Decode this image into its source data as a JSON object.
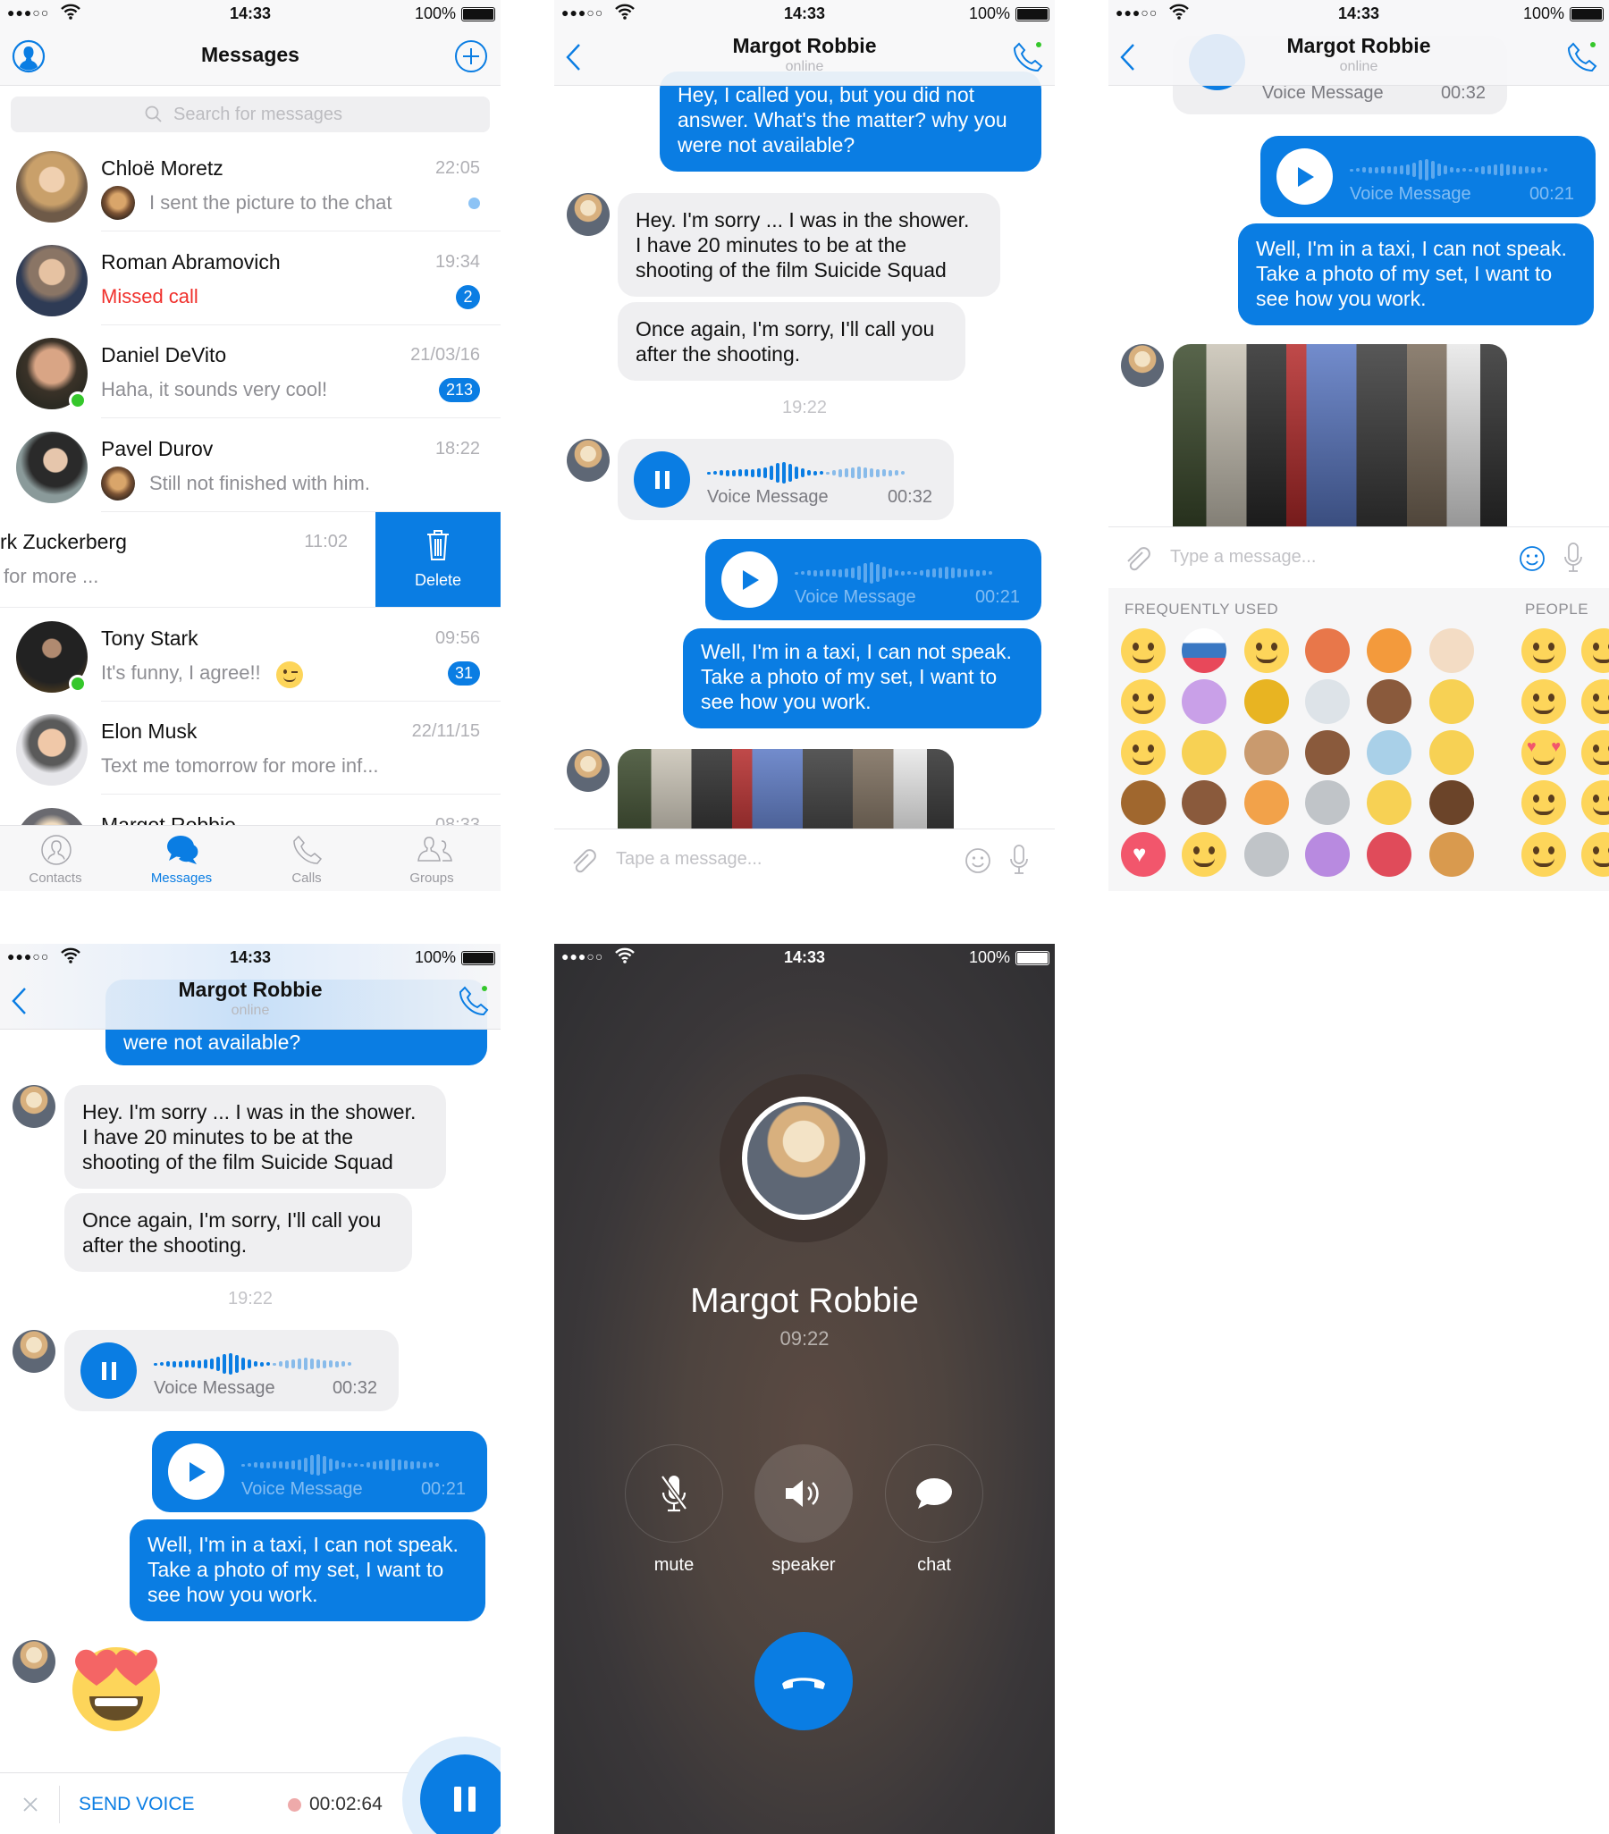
{
  "status_bar": {
    "signal": "●●●○○",
    "time": "14:33",
    "battery": "100%"
  },
  "colors": {
    "accent": "#0a7de3",
    "missed": "#f0302c",
    "online": "#35c72b",
    "end_call": "#0a7de3"
  },
  "messages_screen": {
    "title": "Messages",
    "search_placeholder": "Search for messages",
    "delete_label": "Delete",
    "conversations": [
      {
        "name": "Chloë Moretz",
        "time": "22:05",
        "preview": "I sent the picture to the chat",
        "thumb": true,
        "unread_dot": true
      },
      {
        "name": "Roman Abramovich",
        "time": "19:34",
        "preview": "Missed call",
        "missed": true,
        "badge": "2"
      },
      {
        "name": "Daniel DeVito",
        "time": "21/03/16",
        "preview": "Haha, it sounds very cool!",
        "badge": "213",
        "online": true
      },
      {
        "name": "Pavel Durov",
        "time": "18:22",
        "preview": "Still not finished with him.",
        "thumb": true
      },
      {
        "name": "rk Zuckerberg",
        "time": "11:02",
        "preview": "for more ...",
        "swiped": true
      },
      {
        "name": "Tony Stark",
        "time": "09:56",
        "preview": "It's funny, I agree!!",
        "emoji": "winking-face",
        "badge": "31",
        "online": true
      },
      {
        "name": "Elon Musk",
        "time": "22/11/15",
        "preview": "Text me tomorrow for more inf..."
      },
      {
        "name": "Margot Robbie",
        "time": "08:33",
        "preview": ""
      }
    ],
    "tabs": [
      {
        "label": "Contacts",
        "icon": "contact-icon",
        "active": false
      },
      {
        "label": "Messages",
        "icon": "chat-bubbles-icon",
        "active": true
      },
      {
        "label": "Calls",
        "icon": "phone-icon",
        "active": false
      },
      {
        "label": "Groups",
        "icon": "group-icon",
        "active": false
      }
    ]
  },
  "chat": {
    "contact_name": "Margot Robbie",
    "contact_status": "online",
    "msg_out_1": "Hey, I called you, but you did not\nanswer. What's the matter? why you\nwere not available?",
    "msg_out_1_tail": "were not available?",
    "msg_in_1": "Hey. I'm sorry ... I was in the shower.\nI have 20 minutes to be at the\nshooting of the film Suicide Squad",
    "msg_in_2": "Once again, I'm sorry, I'll call you\nafter the shooting.",
    "timestamp": "19:22",
    "voice_label": "Voice Message",
    "voice_in_duration": "00:32",
    "voice_out_duration": "00:21",
    "msg_out_2": "Well, I'm in a taxi, I can not speak.\nTake a photo of my set, I want to\nsee how you work.",
    "input_placeholder_1": "Tape a message...",
    "input_placeholder_2": "Type a message..."
  },
  "emoji_panel": {
    "section_frequent": "FREQUENTLY USED",
    "section_people": "PEOPLE",
    "frequent": [
      [
        "winking-face",
        "russia-flag",
        "kissing-face",
        "maple-leaf",
        "tropical-drink",
        "prince"
      ],
      [
        "laughing-face",
        "man-dancing",
        "trophy",
        "panda",
        "pile-of-poo",
        "baby-chick"
      ],
      [
        "drooling-face",
        "raising-hands",
        "flexed-biceps",
        "victory-hand",
        "credit-card",
        "ear"
      ],
      [
        "lion",
        "middle-finger",
        "couple-kiss",
        "weary-cat",
        "oncoming-fist",
        "boy"
      ],
      [
        "red-heart",
        "yum-face",
        "smiley-cat",
        "woman-raising-hand",
        "drum",
        "pancakes"
      ]
    ],
    "people": [
      [
        "smirking-face",
        "blushing-face"
      ],
      [
        "sunglasses-face",
        "unamused-face"
      ],
      [
        "heart-eyes-face",
        "tongue-wink-face"
      ],
      [
        "relieved-face",
        "zany-face"
      ],
      [
        "yum-face",
        "tongue-face"
      ]
    ]
  },
  "recording": {
    "send_label": "SEND VOICE",
    "elapsed": "00:02:64"
  },
  "call": {
    "name": "Margot Robbie",
    "duration": "09:22",
    "mute_label": "mute",
    "speaker_label": "speaker",
    "chat_label": "chat"
  }
}
